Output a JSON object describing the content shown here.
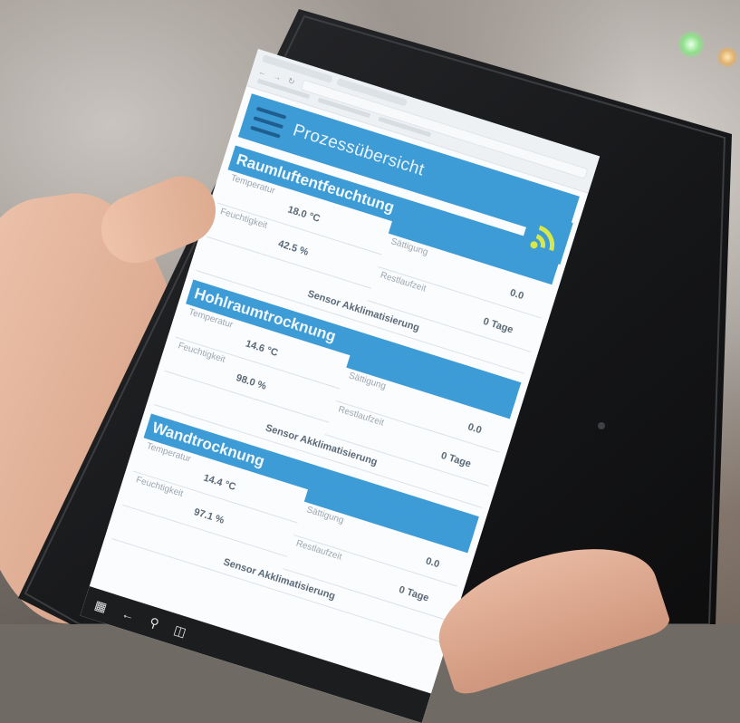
{
  "app": {
    "title": "Prozessübersicht",
    "accent_color": "#3d9bd6"
  },
  "sections": [
    {
      "title": "Raumluftentfeuchtung",
      "temperature_label": "Temperatur",
      "temperature_value": "18.0 °C",
      "humidity_label": "Feuchtigkeit",
      "humidity_value": "42.5 %",
      "saturation_label": "Sättigung",
      "saturation_value": "0.0",
      "remaining_label": "Restlaufzeit",
      "remaining_value": "0 Tage",
      "status": "Sensor Akklimatisierung"
    },
    {
      "title": "Hohlraumtrocknung",
      "temperature_label": "Temperatur",
      "temperature_value": "14.6 °C",
      "humidity_label": "Feuchtigkeit",
      "humidity_value": "98.0 %",
      "saturation_label": "Sättigung",
      "saturation_value": "0.0",
      "remaining_label": "Restlaufzeit",
      "remaining_value": "0 Tage",
      "status": "Sensor Akklimatisierung"
    },
    {
      "title": "Wandtrocknung",
      "temperature_label": "Temperatur",
      "temperature_value": "14.4 °C",
      "humidity_label": "Feuchtigkeit",
      "humidity_value": "97.1 %",
      "saturation_label": "Sättigung",
      "saturation_value": "0.0",
      "remaining_label": "Restlaufzeit",
      "remaining_value": "0 Tage",
      "status": "Sensor Akklimatisierung"
    }
  ],
  "icons": {
    "menu": "hamburger-menu-icon",
    "wifi": "wifi-signal-icon",
    "start": "windows-start-icon",
    "back": "back-arrow-icon",
    "search": "search-icon",
    "taskview": "task-view-icon"
  }
}
